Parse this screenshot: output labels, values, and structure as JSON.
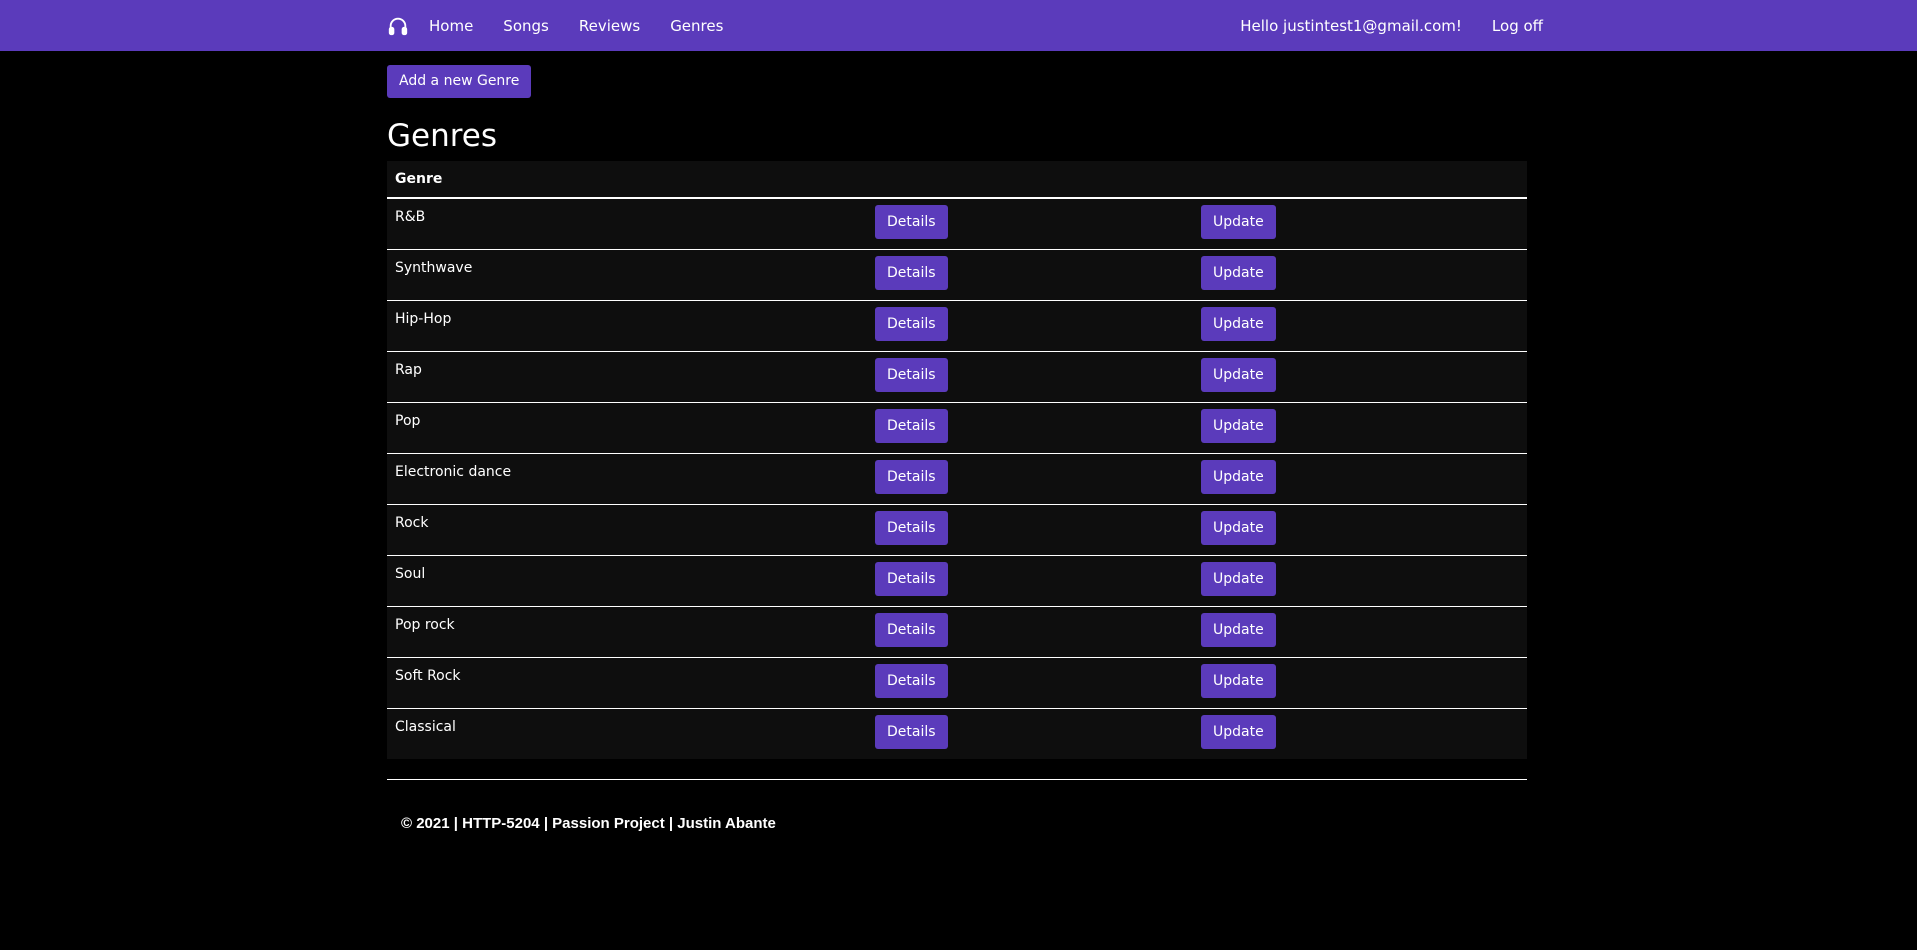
{
  "colors": {
    "accent": "#5b3bbb",
    "background": "#000000",
    "table_background": "#0e0e0e",
    "text": "#ffffff"
  },
  "navbar": {
    "brand_icon": "headphones-icon",
    "links": [
      {
        "label": "Home"
      },
      {
        "label": "Songs"
      },
      {
        "label": "Reviews"
      },
      {
        "label": "Genres"
      }
    ],
    "greeting": "Hello justintest1@gmail.com!",
    "logoff": "Log off"
  },
  "main": {
    "add_button": "Add a new Genre",
    "title": "Genres",
    "table": {
      "header": "Genre",
      "details_label": "Details",
      "update_label": "Update",
      "rows": [
        {
          "name": "R&B"
        },
        {
          "name": "Synthwave"
        },
        {
          "name": "Hip-Hop"
        },
        {
          "name": "Rap"
        },
        {
          "name": "Pop"
        },
        {
          "name": "Electronic dance"
        },
        {
          "name": "Rock"
        },
        {
          "name": "Soul"
        },
        {
          "name": "Pop rock"
        },
        {
          "name": "Soft Rock"
        },
        {
          "name": "Classical"
        }
      ]
    }
  },
  "footer": {
    "text": "© 2021 | HTTP-5204 | Passion Project | Justin Abante"
  }
}
